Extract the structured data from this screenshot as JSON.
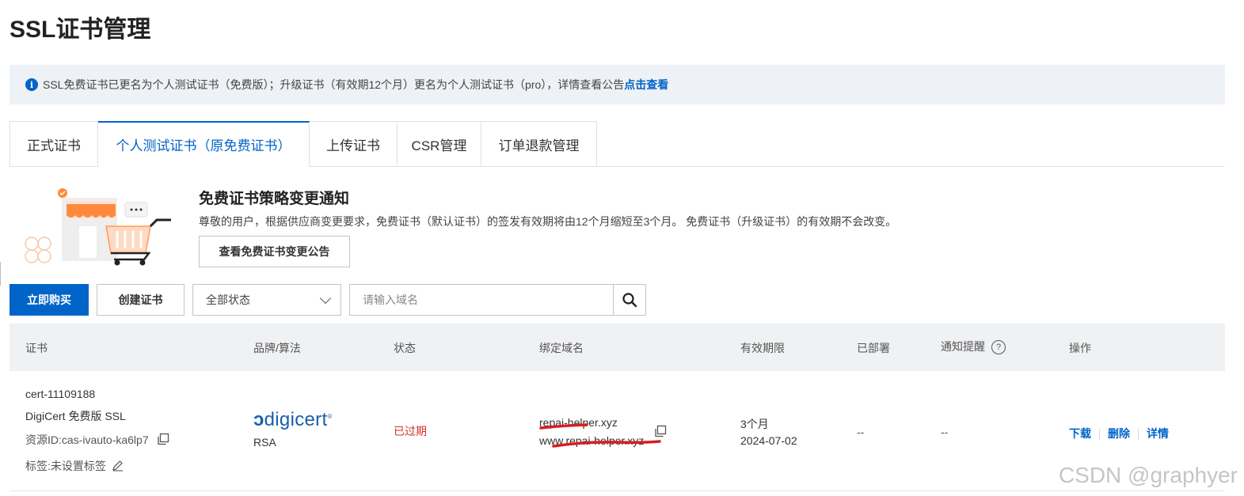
{
  "page": {
    "title": "SSL证书管理"
  },
  "notice": {
    "text": "SSL免费证书已更名为个人测试证书（免费版）；升级证书（有效期12个月）更名为个人测试证书（pro），详情查看公告",
    "link": "点击查看",
    "icon": "info-icon"
  },
  "tabs": [
    {
      "label": "正式证书",
      "active": false
    },
    {
      "label": "个人测试证书（原免费证书）",
      "active": true
    },
    {
      "label": "上传证书",
      "active": false
    },
    {
      "label": "CSR管理",
      "active": false
    },
    {
      "label": "订单退款管理",
      "active": false
    }
  ],
  "promo": {
    "title": "免费证书策略变更通知",
    "desc": "尊敬的用户，根据供应商变更要求，免费证书（默认证书）的签发有效期将由12个月缩短至3个月。 免费证书（升级证书）的有效期不会改变。",
    "button": "查看免费证书变更公告"
  },
  "toolbar": {
    "buy": "立即购买",
    "create": "创建证书",
    "status_select": "全部状态",
    "search_placeholder": "请输入域名"
  },
  "table": {
    "headers": {
      "cert": "证书",
      "brand": "品牌/算法",
      "status": "状态",
      "domain": "绑定域名",
      "validity": "有效期限",
      "deployed": "已部署",
      "notify": "通知提醒",
      "action": "操作"
    },
    "rows": [
      {
        "name": "cert-11109188",
        "product": "DigiCert 免费版 SSL",
        "resource_id": "资源ID:cas-ivauto-ka6lp7",
        "tag": "标签:未设置标签",
        "brand_logo": "digicert",
        "algorithm": "RSA",
        "status": "已过期",
        "domain1": "repai-helper.xyz",
        "domain2": "www.repai-helper.xyz",
        "validity_period": "3个月",
        "validity_date": "2024-07-02",
        "deployed": "--",
        "notify": "--",
        "actions": [
          "下载",
          "删除",
          "详情"
        ]
      }
    ]
  },
  "watermark": "CSDN @graphyer",
  "colors": {
    "primary": "#0064c8",
    "expired": "#d93026",
    "redacted_mark": "#d81e1e"
  }
}
